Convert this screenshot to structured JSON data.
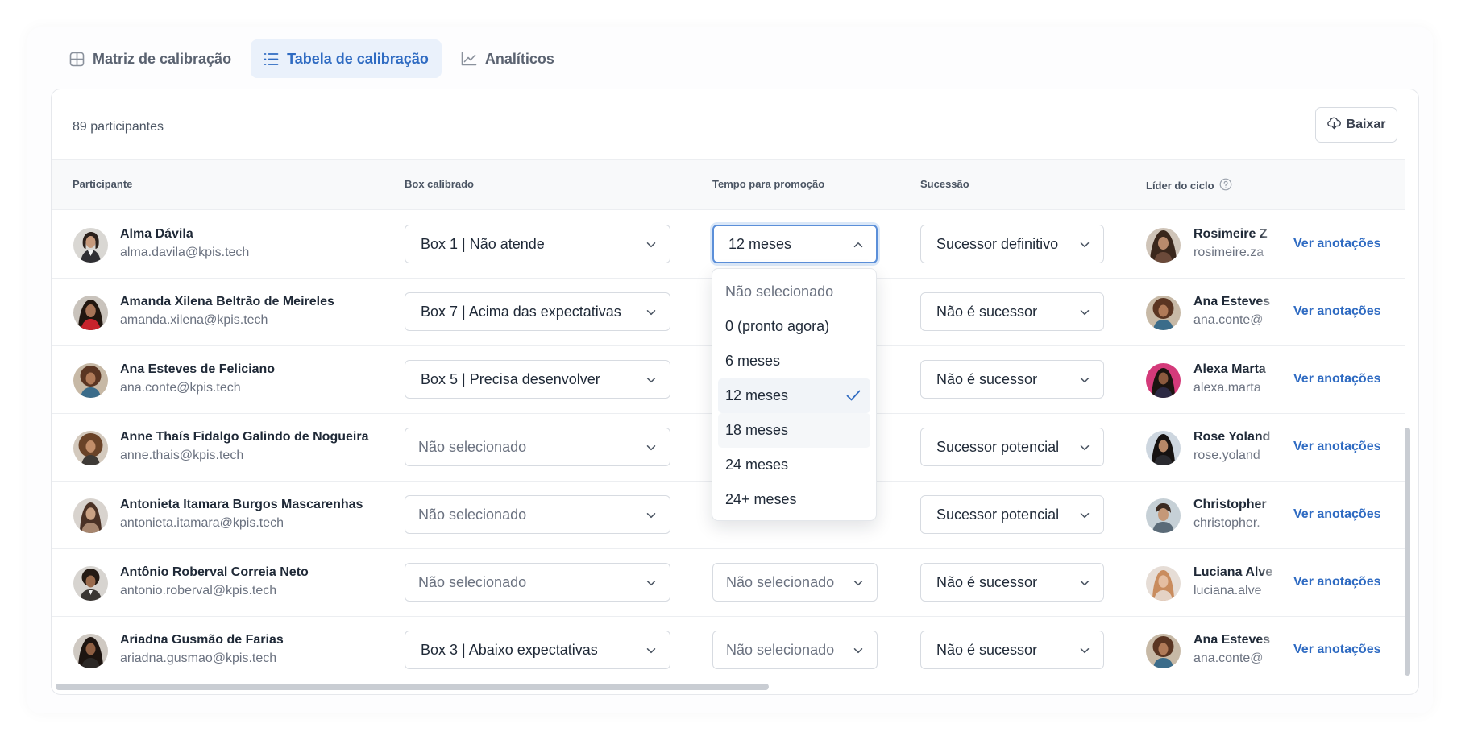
{
  "tabs": [
    {
      "label": "Matriz de calibração",
      "icon": "grid-icon",
      "active": false
    },
    {
      "label": "Tabela de calibração",
      "icon": "list-icon",
      "active": true
    },
    {
      "label": "Analíticos",
      "icon": "line-chart-icon",
      "active": false
    }
  ],
  "toolbar": {
    "count_label": "89 participantes",
    "download_label": "Baixar"
  },
  "table": {
    "headers": {
      "participante": "Participante",
      "box": "Box calibrado",
      "tempo": "Tempo para promoção",
      "sucessao": "Sucessão",
      "lider": "Líder do ciclo"
    },
    "notes_label": "Ver anotações",
    "rows": [
      {
        "name": "Alma Dávila",
        "email": "alma.davila@kpis.tech",
        "box": "Box 1 | Não atende",
        "tempo": "12 meses",
        "sucessao": "Sucessor definitivo",
        "leader_name": "Rosimeire Z",
        "leader_email": "rosimeire.za"
      },
      {
        "name": "Amanda Xilena Beltrão de Meireles",
        "email": "amanda.xilena@kpis.tech",
        "box": "Box 7 | Acima das expectativas",
        "tempo": "",
        "sucessao": "Não é sucessor",
        "leader_name": "Ana Esteves",
        "leader_email": "ana.conte@"
      },
      {
        "name": "Ana Esteves de Feliciano",
        "email": "ana.conte@kpis.tech",
        "box": "Box 5 | Precisa desenvolver",
        "tempo": "",
        "sucessao": "Não é sucessor",
        "leader_name": "Alexa Marta",
        "leader_email": "alexa.marta"
      },
      {
        "name": "Anne Thaís Fidalgo Galindo de Nogueira",
        "email": "anne.thais@kpis.tech",
        "box": "Não selecionado",
        "tempo": "",
        "sucessao": "Sucessor potencial",
        "leader_name": "Rose Yoland",
        "leader_email": "rose.yoland"
      },
      {
        "name": "Antonieta Itamara Burgos Mascarenhas",
        "email": "antonieta.itamara@kpis.tech",
        "box": "Não selecionado",
        "tempo": "",
        "sucessao": "Sucessor potencial",
        "leader_name": "Christopher",
        "leader_email": "christopher."
      },
      {
        "name": "Antônio Roberval Correia Neto",
        "email": "antonio.roberval@kpis.tech",
        "box": "Não selecionado",
        "tempo": "Não selecionado",
        "sucessao": "Não é sucessor",
        "leader_name": "Luciana Alve",
        "leader_email": "luciana.alve"
      },
      {
        "name": "Ariadna Gusmão de Farias",
        "email": "ariadna.gusmao@kpis.tech",
        "box": "Box 3 | Abaixo expectativas",
        "tempo": "Não selecionado",
        "sucessao": "Não é sucessor",
        "leader_name": "Ana Esteves",
        "leader_email": "ana.conte@"
      }
    ]
  },
  "dropdown": {
    "options": [
      "Não selecionado",
      "0 (pronto agora)",
      "6 meses",
      "12 meses",
      "18 meses",
      "24 meses",
      "24+ meses"
    ],
    "selected": "12 meses"
  },
  "colors": {
    "accent": "#2f6bc2",
    "active_tab_bg": "#eaf1fb",
    "focus_ring": "#5b8fd9",
    "border": "#d7dbe1"
  }
}
